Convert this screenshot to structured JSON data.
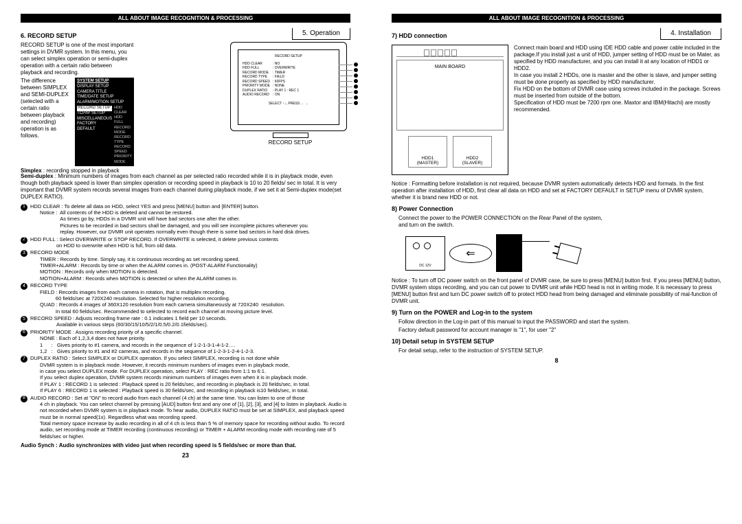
{
  "header": "ALL ABOUT IMAGE RECOGNITION & PROCESSING",
  "left": {
    "crumb_num": "5. Operation",
    "section": "6. RECORD SETUP",
    "intro": "RECORD SETUP is one of the most important settings in DVMR system. In this menu, you can select simplex operation or semi-duplex operation with a certain ratio between playback and recording.",
    "diff": "The difference between SIMPLEX and SEMI-DUPLEX (selected with a certain ratio between playback and recording) operation is as follows.",
    "simplex_label": "Simplex",
    "simplex_text": ": recording stopped in playback",
    "semi_label": "Semi-duplex",
    "semi_text": ": Minimum numbers of images from each channel as per selected ratio recorded while it is in playback mode, even though both playback speed is lower than simplex operation or recording speed in playback is 10 to 20 fields/ sec in total. It is very important that DVMR system records several images from each channel during playback mode, if we set it at Semi-duplex mode(set DUPLEX RATIO).",
    "system_setup": {
      "title": "SYSTEM SETUP",
      "items": [
        "DISPLAY SETUP",
        "CAMERA TITLE",
        "TIME/DATE SETUP",
        "ALARM/MOTION SETUP",
        "RECORD SETUP",
        "TCP/IP SETUP",
        "MISCELLANEOUS",
        "FACTORY DEFAULT"
      ],
      "sub": [
        "HDD CLEAR",
        "HDD FULL",
        "RECORD MODE",
        "RECORD TYPE",
        "RECORD SPEED",
        "PRIORITY MODE"
      ]
    },
    "monitor_caption": "RECORD SETUP",
    "screen": {
      "title": "RECORD SETUP",
      "rows": [
        [
          "HDD CLEAR",
          ": NO"
        ],
        [
          "HDD FULL",
          ": OVERWRITE"
        ],
        [
          "RECORD MODE",
          ": TIMER"
        ],
        [
          "RECORD TYPE",
          ": FIELD"
        ],
        [
          "RECORD SPEED",
          ": 60FPS"
        ],
        [
          "PRIORITY MODE",
          ": NONE"
        ],
        [
          "DUPLEX RATIO",
          ": PLAY 1 : REC 1"
        ],
        [
          "AUDIO RECORD",
          ": ON"
        ]
      ],
      "footer": "SELECT ↑↓,  PRESS  ← →"
    },
    "items": [
      {
        "n": "1",
        "title": "HDD CLEAR : To delete all data on HDD, select YES and press [MENU] button and [ENTER] button.",
        "body": "Notice :  All contents of the HDD is deleted and cannot be restored.\n              As times go by, HDDs in a DVMR unit will have bad sectors one after the other.\n              Pictures to be recorded in bad sectors shall be damaged, and you will see incomplete pictures whenever you\n              replay. However, our DVMR unit operates normally even though there is some bad sectors in hard disk drives."
      },
      {
        "n": "2",
        "title": "HDD FULL : Select OVERWRITE or STOP RECORD. If OVERWRITE is selected, it delete previous contents",
        "body": "on HDD to overwrite when HDD is full, from old data."
      },
      {
        "n": "3",
        "title": "RECORD MODE",
        "body": "TIMER : Records by time. Simply say, it is continuous recording as set recording speed.\nTIMER+ALARM : Records by time or when the ALARM comes in. (POST-ALARM Functionality)\nMOTION : Records only when MOTION is detected.\nMOTION+ALARM : Records when MOTION is detected or when the ALARM comes in."
      },
      {
        "n": "4",
        "title": "RECORD TYPE",
        "body": "FIELD : Records images from each camera in rotation, that is multiplex recording.\n           60 fields/sec at 720X240 resolution. Selected for higher resolution recording.\nQUAD : Records 4 images of 360X120 resolution from each camera simultaneously at 720X240  resolution.\n           In total 60 fields/sec. Recommended to selected to record each channel at moving picture level."
      },
      {
        "n": "5",
        "title": "RECORD SPEED : Adjusts recording frame rate : 0.1 indicates 1 field per 10 seconds.",
        "body": "Available in various steps (60/30/15/10/5/2/1/0.5/0.2/0.1fields/sec)."
      },
      {
        "n": "6",
        "title": "PRIORITY MODE : Assigns recording priority of a specific channel.",
        "body": "NONE : Each of 1,2,3,4 does not have priority.\n1      :   Gives priority to #1 camera, and records in the sequence of 1-2-1-3-1-4-1-2….\n1,2   :   Gives priority to #1 and #2 cameras, and records in the sequence of 1-2-3-1-2-4-1-2-3."
      },
      {
        "n": "7",
        "title": "DUPLEX RATIO : Select SIMPLEX or DUPLEX operation. If you select SIMPLEX, recording is not done while",
        "body": "DVMR system is in playback mode. However, it records minimum numbers of images even in playback mode,\nin case you select DUPLEX mode. For DUPLEX operation, select PLAY : REC ratio from 1:1 to 6:1.\nIf you select duplex operation, DVMR system records minimum numbers of images even when it is in playback mode.\nIf PLAY 1 : RECORD 1 is selected : Playback speed is 20 fields/sec, and recording in playback is 20 fields/sec, in total.\nIf PLAY 6 : RECORD 1 is selected : Playback speed is 30 fields/sec, and recording in playback is10 fields/sec, in total."
      },
      {
        "n": "8",
        "title": "AUDIO RECORD : Set at \"ON\" to record audio from each channel (4 ch) at the same time. You can listen to one of those",
        "body": "4 ch in playback. You can select channel by pressing [AUD] button first and any one of [1], [2], [3], and [4] to listen in playback. Audio is not recorded when DVMR system is in playback mode. To hear audio, DUPLEX RATIO must be set at SIMPLEX, and playback speed must be in normal speed(1x). Regardless what was recording speed.\nTotal memory space increase by audio recording in all of 4 ch is less than 5 % of memory space for recording without audio. To record audio, set recording mode at TIMER recording (continuous recording) or TIMER + ALARM recording mode with recording rate of 5 fields/sec or higher."
      }
    ],
    "audio_synch": "Audio Synch : Audio synchronizes with video just when recording speed is 5 fields/sec or more than that.",
    "pagenum": "23"
  },
  "right": {
    "crumb_num": "4. Installation",
    "section7": "7) HDD connection",
    "board": {
      "main": "MAIN BOARD",
      "h1a": "HDD1",
      "h1b": "(MASTER)",
      "h2a": "HDD2",
      "h2b": "(SLAVER)"
    },
    "hdd_text": "Connect main board and HDD using IDE HDD cable and power cable included in the package.If you install just a unit of HDD, jumper setting of HDD must be on Mater, as specified by HDD manufacturer, and you can install it at any location of HDD1 or HDD2.\nIn case you install 2 HDDs, one is master and the other is slave, and jumper setting must be done properly as specified by HDD manufacturer.\nFix HDD on the bottom of DVMR case using screws included in the package. Screws must be inserted from outside of the bottom.\nSpecification of HDD must be 7200 rpm one. Maxtor and IBM(Hitachi) are mostly recommended.",
    "notice7": "Notice : Formatting before installation is not required, because DVMR system automatically detects HDD and formats. In the first operation after installation of HDD, first clear all data on HDD and set at FACTORY DEFAULT in SETUP menu of DVMR system, whether it is brand new HDD or not.",
    "section8": "8) Power Connection",
    "power_text": "Connect the power to the POWER CONNECTION on the Rear Panel of the system,\nand turn on the switch.",
    "dc_label": "DC 12V",
    "notice8": "Notice : To turn off DC power switch on the front panel of DVMR case, be sure to press [MENU] button first. If you press [MENU] button, DVMR system stops recording, and you can cut power to DVMR unit while HDD head is not in writing mode. It is necessary to press [MENU] button first and turn DC power switch off to protect HDD head from being damaged and eliminate possibility of mal-function of DVMR unit.",
    "section9": "9) Turn on the POWER and Log-in to the system",
    "text9a": "Follow direction in the Log-in part of this manual to input the PASSWORD and start the system.",
    "text9b": "Factory default password for account manager is \"1\", for user \"2\"",
    "section10": "10) Detail setup in SYSTEM SETUP",
    "text10": "For detail setup, refer to the instruction of SYSTEM SETUP.",
    "pagenum": "8"
  }
}
